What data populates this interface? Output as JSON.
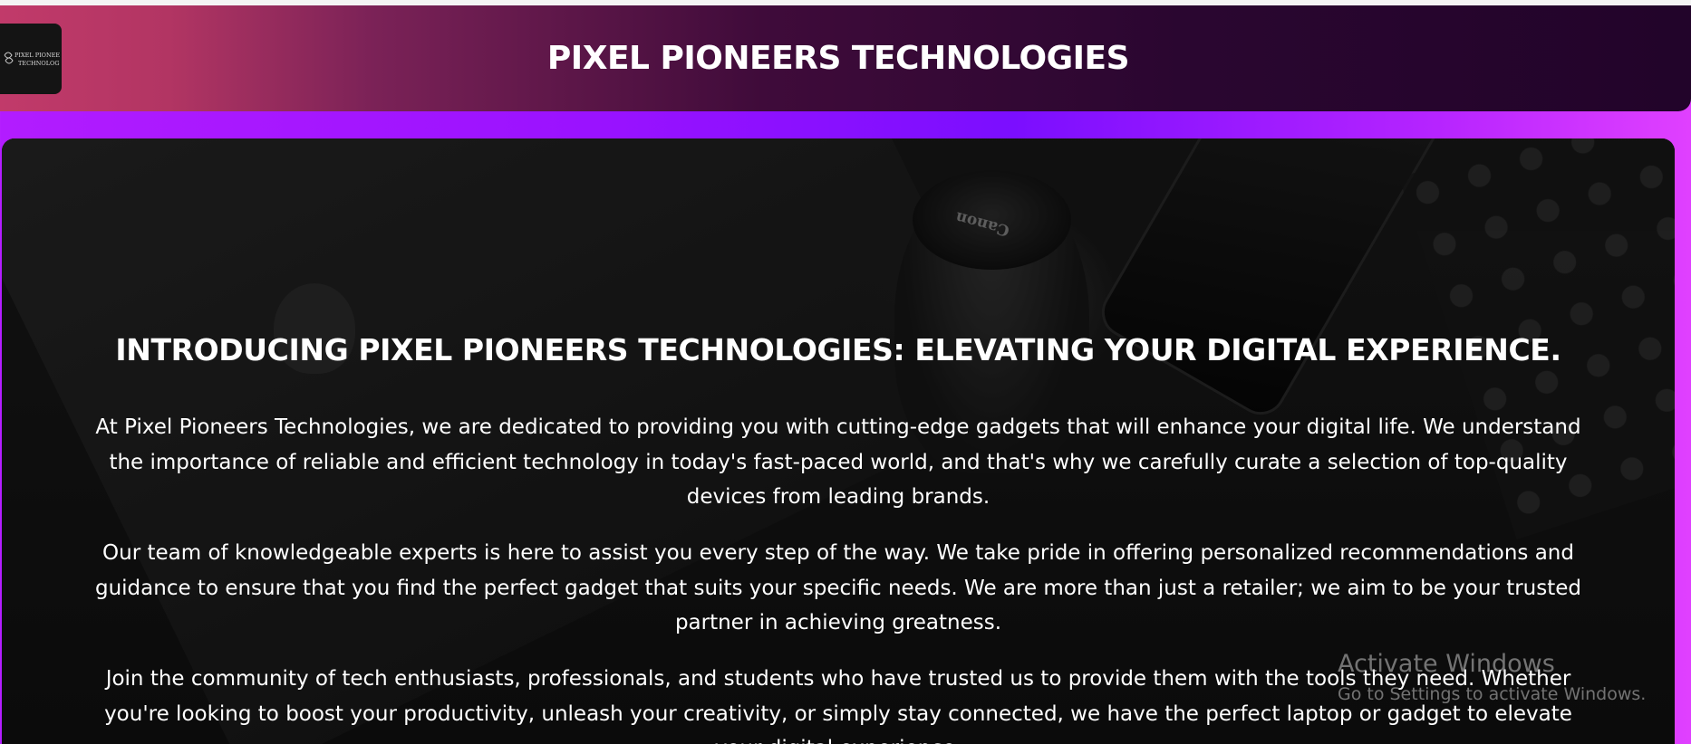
{
  "header": {
    "logo_text": "PIXEL PIONEERS TECHNOLOGIES",
    "title": "PIXEL PIONEERS TECHNOLOGIES"
  },
  "hero": {
    "heading": "INTRODUCING PIXEL PIONEERS TECHNOLOGIES: ELEVATING YOUR DIGITAL EXPERIENCE.",
    "paragraphs": [
      "At Pixel Pioneers Technologies, we are dedicated to providing you with cutting-edge gadgets that will enhance your digital life. We understand the importance of reliable and efficient technology in today's fast-paced world, and that's why we carefully curate a selection of top-quality devices from leading brands.",
      "Our team of knowledgeable experts is here to assist you every step of the way. We take pride in offering personalized recommendations and guidance to ensure that you find the perfect gadget that suits your specific needs. We are more than just a retailer; we aim to be your trusted partner in achieving greatness.",
      "Join the community of tech enthusiasts, professionals, and students who have trusted us to provide them with the tools they need. Whether you're looking to boost your productivity, unleash your creativity, or simply stay connected, we have the perfect laptop or gadget to elevate your digital experience."
    ],
    "background_lens_brand": "Canon"
  },
  "watermark": {
    "title": "Activate Windows",
    "subtitle": "Go to Settings to activate Windows."
  },
  "colors": {
    "header_gradient_start": "#c13a6a",
    "header_gradient_end": "#22042a",
    "page_accent": "#9a12ff"
  }
}
